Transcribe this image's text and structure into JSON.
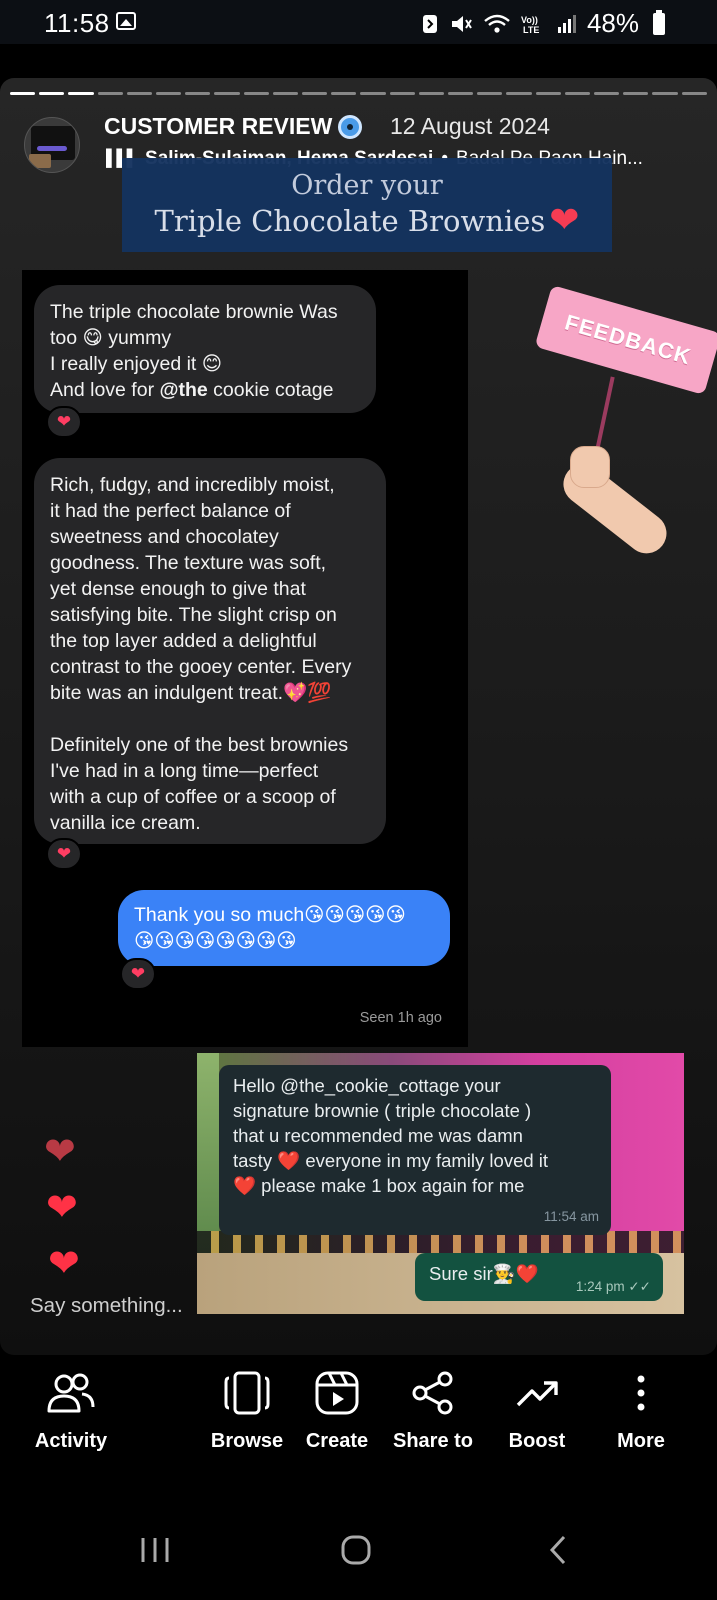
{
  "status_bar": {
    "time": "11:58",
    "battery": "48%",
    "icons": [
      "gallery-icon",
      "nfc-icon",
      "mute-icon",
      "wifi-icon",
      "volte-icon",
      "signal-icon",
      "battery-icon"
    ]
  },
  "story": {
    "title": "CUSTOMER REVIEW",
    "date": "12 August 2024",
    "music": {
      "artist": "Salim-Sulaiman, Hema Sardesai",
      "song": "Badal Pe Paon Hain..."
    },
    "banner": {
      "line1": "Order your",
      "line2": "Triple Chocolate Brownies"
    },
    "chat": {
      "message1": [
        "The triple chocolate brownie Was",
        "too 😋 yummy",
        "I really enjoyed it 😊",
        "And love for @the cookie cotage"
      ],
      "message2": [
        "Rich, fudgy, and incredibly moist,",
        "it had the perfect balance of",
        "sweetness and chocolatey",
        "goodness. The texture was soft,",
        "yet dense enough to give that",
        "satisfying bite. The slight crisp on",
        "the top layer added a delightful",
        "contrast to the gooey center. Every",
        "bite was an indulgent treat.💖💯",
        "",
        "Definitely one of the best brownies",
        "I've had in a long time—perfect",
        "with a cup of coffee or a scoop of",
        "vanilla ice cream."
      ],
      "reply": [
        "Thank you so much😘😘😘😘😘",
        "😘😘😘😘😘😘😘😘"
      ],
      "reaction": "❤",
      "seen": "Seen 1h ago"
    },
    "sticker_text": "FEEDBACK",
    "whatsapp": {
      "incoming": [
        "Hello @the_cookie_cottage your",
        "signature brownie ( triple chocolate )",
        "that u recommended me was damn",
        "tasty ❤️ everyone in my family loved it",
        "❤️ please make 1 box again for me"
      ],
      "incoming_time": "11:54 am",
      "outgoing": "Sure sir👨‍🍳❤️",
      "outgoing_time": "1:24 pm ✓✓"
    },
    "say_something": "Say something..."
  },
  "toolbar": {
    "activity": "Activity",
    "browse": "Browse",
    "create": "Create",
    "share": "Share to",
    "boost": "Boost",
    "more": "More"
  },
  "colors": {
    "bubble_blue": "#3a82f7",
    "bubble_gray": "#262628",
    "heart": "#ff3246",
    "sticker_pink": "#f7a6c6"
  }
}
